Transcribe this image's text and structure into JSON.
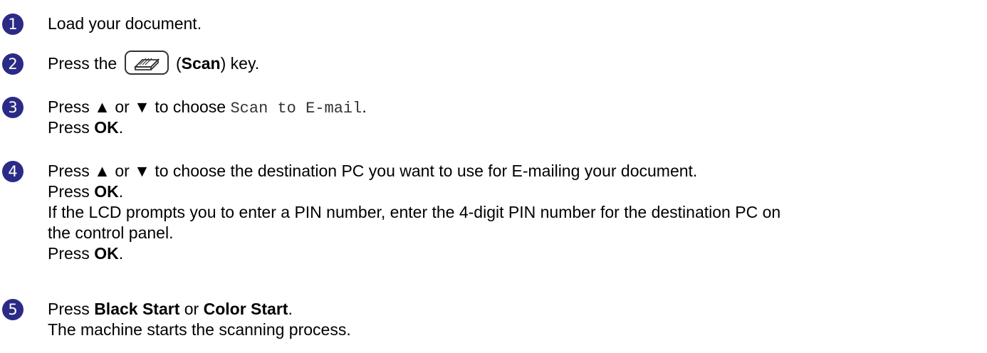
{
  "steps": [
    {
      "number": "1",
      "text": "Load your document."
    },
    {
      "number": "2",
      "text_before": "Press the",
      "key_open": "(",
      "key_label": "Scan",
      "key_close": ")",
      "text_after": "key.",
      "key_icon": "scanner-key-icon"
    },
    {
      "number": "3",
      "line1_prefix": "Press ▲ or ▼ to choose ",
      "line1_menu": "Scan to E-mail",
      "line1_end": ".",
      "line2_prefix": "Press ",
      "line2_key": "OK",
      "line2_end": "."
    },
    {
      "number": "4",
      "line1": "Press ▲ or ▼ to choose the destination PC you want to use for E-mailing your document.",
      "line2_prefix": "Press ",
      "line2_key": "OK",
      "line2_end": ".",
      "line3": "If the LCD prompts you to enter a PIN number, enter the 4-digit PIN number for the destination PC on",
      "line4": "the control panel.",
      "line5_prefix": "Press ",
      "line5_key": "OK",
      "line5_end": "."
    },
    {
      "number": "5",
      "line1_prefix": "Press ",
      "line1_key1": "Black Start",
      "line1_mid": " or ",
      "line1_key2": "Color Start",
      "line1_end": ".",
      "line2": "The machine starts the scanning process."
    }
  ],
  "colors": {
    "step_number_bg": "#2b2a86",
    "step_number_fg": "#ffffff",
    "text": "#000000",
    "menu_text": "#333333"
  }
}
